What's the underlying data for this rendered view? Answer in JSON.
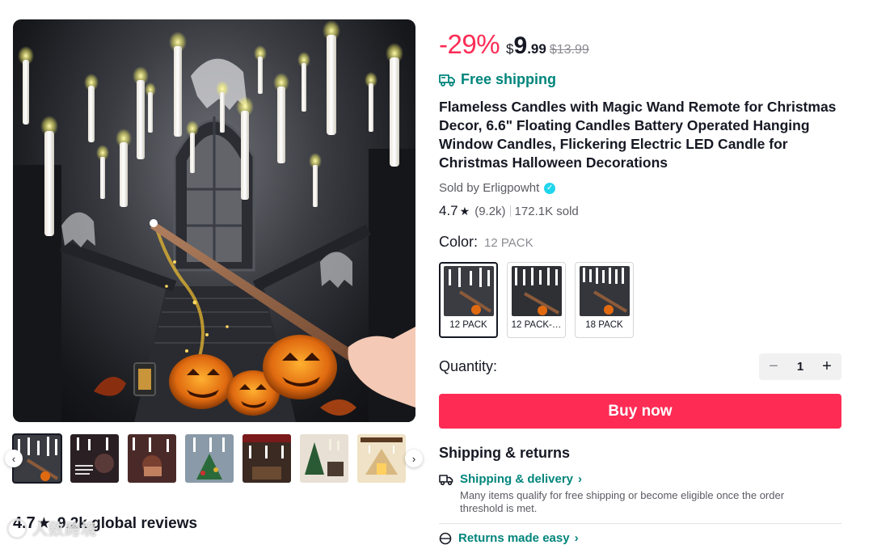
{
  "product": {
    "discount": "-29%",
    "currency": "$",
    "price_int": "9",
    "price_dec": ".99",
    "price_old": "$13.99",
    "shipping": "Free shipping",
    "title": "Flameless Candles with Magic Wand Remote for Christmas Decor, 6.6\" Floating Candles Battery Operated Hanging Window Candles, Flickering Electric LED Candle for Christmas Halloween Decorations",
    "sold_by": "Sold by Erligpowht",
    "rating": "4.7",
    "rating_count": "(9.2k)",
    "sold": "172.1K sold"
  },
  "color": {
    "label": "Color:",
    "selected": "12 PACK",
    "options": [
      {
        "label": "12 PACK"
      },
      {
        "label": "12 PACK-…"
      },
      {
        "label": "18 PACK"
      }
    ]
  },
  "quantity": {
    "label": "Quantity:",
    "value": "1",
    "minus": "−",
    "plus": "+"
  },
  "buy": {
    "label": "Buy now"
  },
  "shipping_returns": {
    "title": "Shipping & returns",
    "delivery_label": "Shipping & delivery",
    "delivery_desc": "Many items qualify for free shipping or become eligible once the order threshold is met.",
    "returns_label": "Returns made easy"
  },
  "gallery": {
    "prev": "‹",
    "next": "›"
  },
  "reviews": {
    "rating": "4.7",
    "summary": "9.2k global reviews"
  },
  "watermark": {
    "text": "人数跨境"
  },
  "colors": {
    "accent": "#fe2c55",
    "teal": "#01857c",
    "verified": "#20d5ec"
  }
}
